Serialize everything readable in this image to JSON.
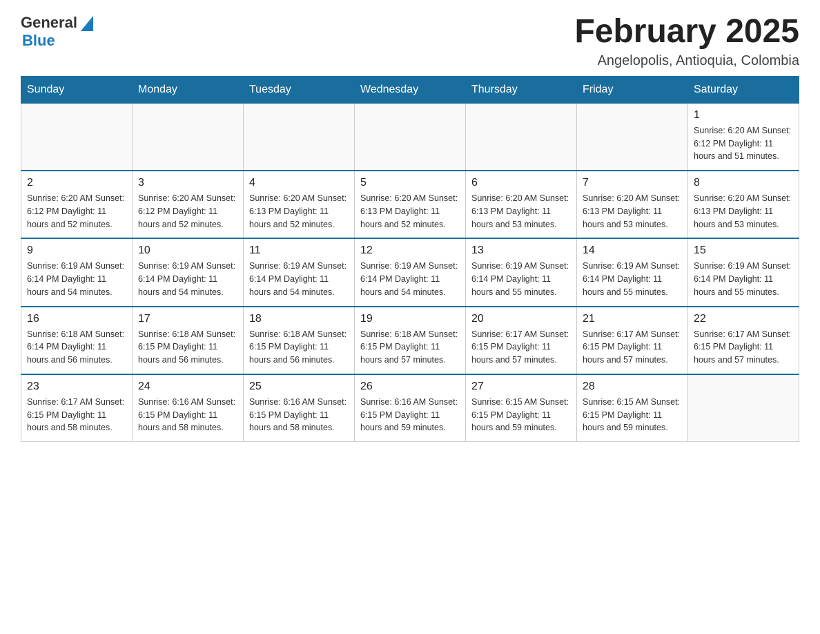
{
  "header": {
    "logo": {
      "text_general": "General",
      "triangle": "▶",
      "text_blue": "Blue"
    },
    "title": "February 2025",
    "subtitle": "Angelopolis, Antioquia, Colombia"
  },
  "days_of_week": [
    "Sunday",
    "Monday",
    "Tuesday",
    "Wednesday",
    "Thursday",
    "Friday",
    "Saturday"
  ],
  "weeks": [
    {
      "days": [
        {
          "number": "",
          "info": ""
        },
        {
          "number": "",
          "info": ""
        },
        {
          "number": "",
          "info": ""
        },
        {
          "number": "",
          "info": ""
        },
        {
          "number": "",
          "info": ""
        },
        {
          "number": "",
          "info": ""
        },
        {
          "number": "1",
          "info": "Sunrise: 6:20 AM\nSunset: 6:12 PM\nDaylight: 11 hours\nand 51 minutes."
        }
      ]
    },
    {
      "days": [
        {
          "number": "2",
          "info": "Sunrise: 6:20 AM\nSunset: 6:12 PM\nDaylight: 11 hours\nand 52 minutes."
        },
        {
          "number": "3",
          "info": "Sunrise: 6:20 AM\nSunset: 6:12 PM\nDaylight: 11 hours\nand 52 minutes."
        },
        {
          "number": "4",
          "info": "Sunrise: 6:20 AM\nSunset: 6:13 PM\nDaylight: 11 hours\nand 52 minutes."
        },
        {
          "number": "5",
          "info": "Sunrise: 6:20 AM\nSunset: 6:13 PM\nDaylight: 11 hours\nand 52 minutes."
        },
        {
          "number": "6",
          "info": "Sunrise: 6:20 AM\nSunset: 6:13 PM\nDaylight: 11 hours\nand 53 minutes."
        },
        {
          "number": "7",
          "info": "Sunrise: 6:20 AM\nSunset: 6:13 PM\nDaylight: 11 hours\nand 53 minutes."
        },
        {
          "number": "8",
          "info": "Sunrise: 6:20 AM\nSunset: 6:13 PM\nDaylight: 11 hours\nand 53 minutes."
        }
      ]
    },
    {
      "days": [
        {
          "number": "9",
          "info": "Sunrise: 6:19 AM\nSunset: 6:14 PM\nDaylight: 11 hours\nand 54 minutes."
        },
        {
          "number": "10",
          "info": "Sunrise: 6:19 AM\nSunset: 6:14 PM\nDaylight: 11 hours\nand 54 minutes."
        },
        {
          "number": "11",
          "info": "Sunrise: 6:19 AM\nSunset: 6:14 PM\nDaylight: 11 hours\nand 54 minutes."
        },
        {
          "number": "12",
          "info": "Sunrise: 6:19 AM\nSunset: 6:14 PM\nDaylight: 11 hours\nand 54 minutes."
        },
        {
          "number": "13",
          "info": "Sunrise: 6:19 AM\nSunset: 6:14 PM\nDaylight: 11 hours\nand 55 minutes."
        },
        {
          "number": "14",
          "info": "Sunrise: 6:19 AM\nSunset: 6:14 PM\nDaylight: 11 hours\nand 55 minutes."
        },
        {
          "number": "15",
          "info": "Sunrise: 6:19 AM\nSunset: 6:14 PM\nDaylight: 11 hours\nand 55 minutes."
        }
      ]
    },
    {
      "days": [
        {
          "number": "16",
          "info": "Sunrise: 6:18 AM\nSunset: 6:14 PM\nDaylight: 11 hours\nand 56 minutes."
        },
        {
          "number": "17",
          "info": "Sunrise: 6:18 AM\nSunset: 6:15 PM\nDaylight: 11 hours\nand 56 minutes."
        },
        {
          "number": "18",
          "info": "Sunrise: 6:18 AM\nSunset: 6:15 PM\nDaylight: 11 hours\nand 56 minutes."
        },
        {
          "number": "19",
          "info": "Sunrise: 6:18 AM\nSunset: 6:15 PM\nDaylight: 11 hours\nand 57 minutes."
        },
        {
          "number": "20",
          "info": "Sunrise: 6:17 AM\nSunset: 6:15 PM\nDaylight: 11 hours\nand 57 minutes."
        },
        {
          "number": "21",
          "info": "Sunrise: 6:17 AM\nSunset: 6:15 PM\nDaylight: 11 hours\nand 57 minutes."
        },
        {
          "number": "22",
          "info": "Sunrise: 6:17 AM\nSunset: 6:15 PM\nDaylight: 11 hours\nand 57 minutes."
        }
      ]
    },
    {
      "days": [
        {
          "number": "23",
          "info": "Sunrise: 6:17 AM\nSunset: 6:15 PM\nDaylight: 11 hours\nand 58 minutes."
        },
        {
          "number": "24",
          "info": "Sunrise: 6:16 AM\nSunset: 6:15 PM\nDaylight: 11 hours\nand 58 minutes."
        },
        {
          "number": "25",
          "info": "Sunrise: 6:16 AM\nSunset: 6:15 PM\nDaylight: 11 hours\nand 58 minutes."
        },
        {
          "number": "26",
          "info": "Sunrise: 6:16 AM\nSunset: 6:15 PM\nDaylight: 11 hours\nand 59 minutes."
        },
        {
          "number": "27",
          "info": "Sunrise: 6:15 AM\nSunset: 6:15 PM\nDaylight: 11 hours\nand 59 minutes."
        },
        {
          "number": "28",
          "info": "Sunrise: 6:15 AM\nSunset: 6:15 PM\nDaylight: 11 hours\nand 59 minutes."
        },
        {
          "number": "",
          "info": ""
        }
      ]
    }
  ]
}
